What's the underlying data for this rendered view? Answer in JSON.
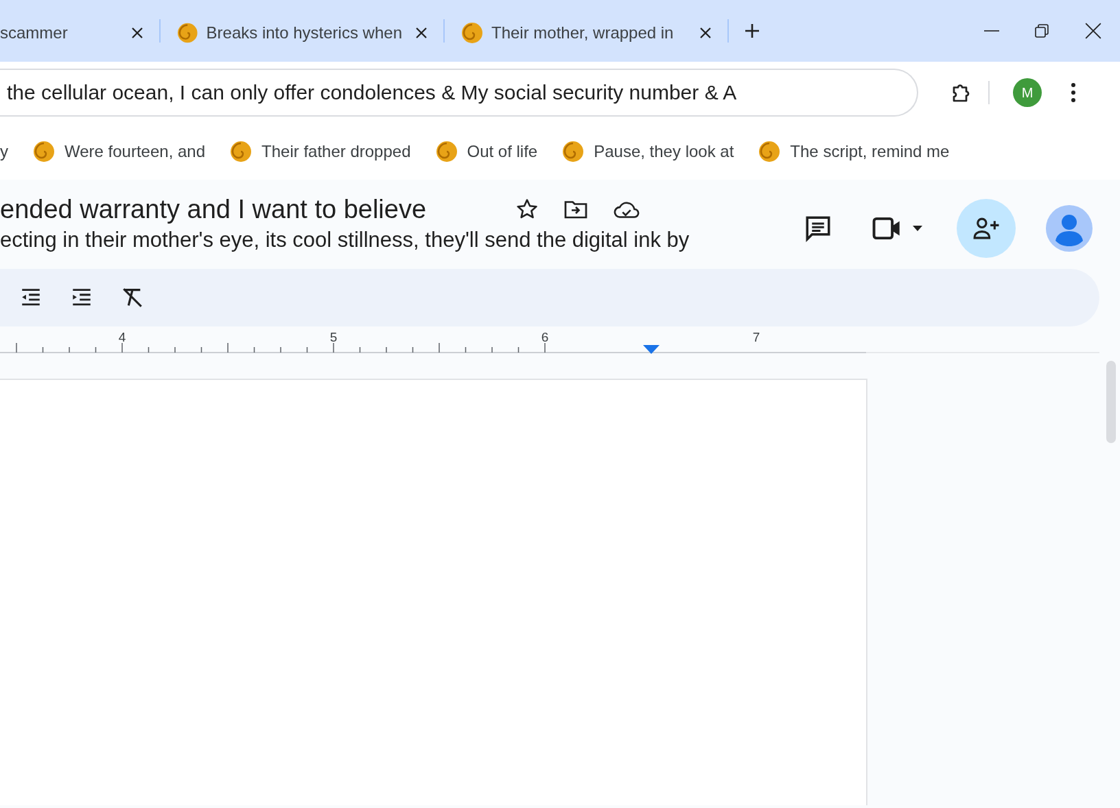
{
  "tabs": [
    {
      "title": "scammer",
      "icon": false,
      "selected": false
    },
    {
      "title": "Breaks into hysterics when",
      "icon": true,
      "selected": false
    },
    {
      "title": "Their mother, wrapped in",
      "icon": true,
      "selected": false
    }
  ],
  "address": {
    "value": "the cellular ocean, I can only offer condolences & My social security number & A"
  },
  "profile": {
    "initial": "M"
  },
  "bookmarks": [
    {
      "label": "y",
      "icon": false
    },
    {
      "label": "Were fourteen, and",
      "icon": true
    },
    {
      "label": "Their father dropped",
      "icon": true
    },
    {
      "label": "Out of life",
      "icon": true
    },
    {
      "label": "Pause, they look at",
      "icon": true
    },
    {
      "label": "The script, remind me",
      "icon": true
    }
  ],
  "document": {
    "title": "ended warranty and I want to believe",
    "subtitle": "ecting in their mother's eye, its cool stillness, they'll send the digital ink by"
  },
  "ruler": {
    "labels": [
      "4",
      "5",
      "6",
      "7"
    ]
  }
}
